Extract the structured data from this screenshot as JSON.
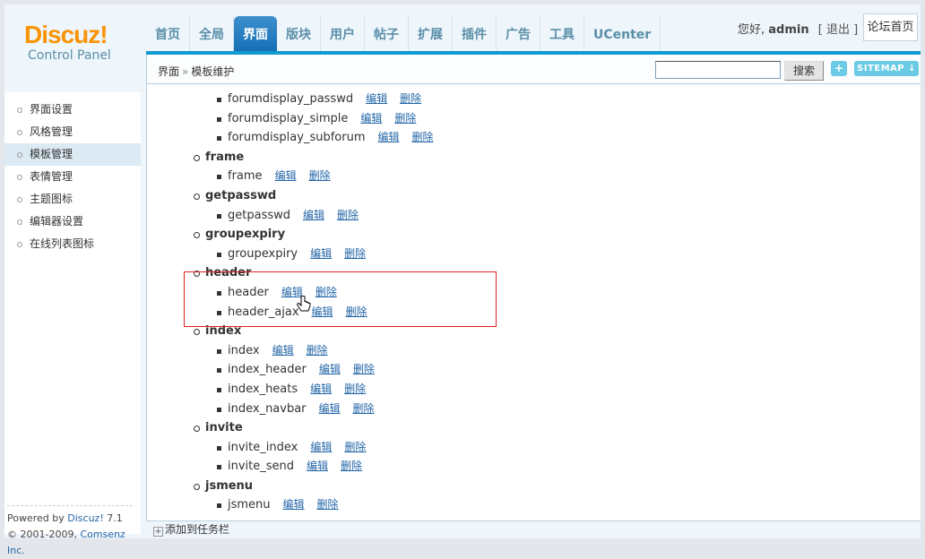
{
  "logo": {
    "brand": "Discuz!",
    "subtitle": "Control Panel"
  },
  "nav": {
    "tabs": [
      "首页",
      "全局",
      "界面",
      "版块",
      "用户",
      "帖子",
      "扩展",
      "插件",
      "广告",
      "工具",
      "UCenter"
    ],
    "active": 2
  },
  "user": {
    "greeting": "您好,",
    "name": "admin",
    "logout": "[ 退出 ]",
    "forum_home": "论坛首页"
  },
  "breadcrumb": {
    "parent": "界面",
    "sep": "»",
    "current": "模板维护"
  },
  "search": {
    "value": "",
    "button": "搜索"
  },
  "toolbar": {
    "plus": "+",
    "sitemap": "SITEMAP ↓"
  },
  "sidebar": {
    "items": [
      "界面设置",
      "风格管理",
      "模板管理",
      "表情管理",
      "主题图标",
      "编辑器设置",
      "在线列表图标"
    ],
    "active": 2
  },
  "footer": {
    "powered_prefix": "Powered by",
    "powered_link": "Discuz!",
    "version": "7.1",
    "copyright_prefix": "© 2001-2009,",
    "copyright_link": "Comsenz Inc."
  },
  "tree": {
    "edit": "编辑",
    "delete": "删除",
    "rows": [
      {
        "type": "item",
        "name": "forumdisplay_passwd"
      },
      {
        "type": "item",
        "name": "forumdisplay_simple"
      },
      {
        "type": "item",
        "name": "forumdisplay_subforum"
      },
      {
        "type": "group",
        "name": "frame"
      },
      {
        "type": "item",
        "name": "frame"
      },
      {
        "type": "group",
        "name": "getpasswd"
      },
      {
        "type": "item",
        "name": "getpasswd"
      },
      {
        "type": "group",
        "name": "groupexpiry"
      },
      {
        "type": "item",
        "name": "groupexpiry"
      },
      {
        "type": "group",
        "name": "header"
      },
      {
        "type": "item",
        "name": "header"
      },
      {
        "type": "item",
        "name": "header_ajax"
      },
      {
        "type": "group",
        "name": "index"
      },
      {
        "type": "item",
        "name": "index"
      },
      {
        "type": "item",
        "name": "index_header"
      },
      {
        "type": "item",
        "name": "index_heats"
      },
      {
        "type": "item",
        "name": "index_navbar"
      },
      {
        "type": "group",
        "name": "invite"
      },
      {
        "type": "item",
        "name": "invite_index"
      },
      {
        "type": "item",
        "name": "invite_send"
      },
      {
        "type": "group",
        "name": "jsmenu"
      },
      {
        "type": "item",
        "name": "jsmenu"
      }
    ]
  },
  "taskbar": {
    "label": "添加到任务栏"
  },
  "colors": {
    "accent": "#0e9bcf",
    "logo": "#f89406",
    "link": "#2366a8",
    "highlight": "#e02020"
  }
}
